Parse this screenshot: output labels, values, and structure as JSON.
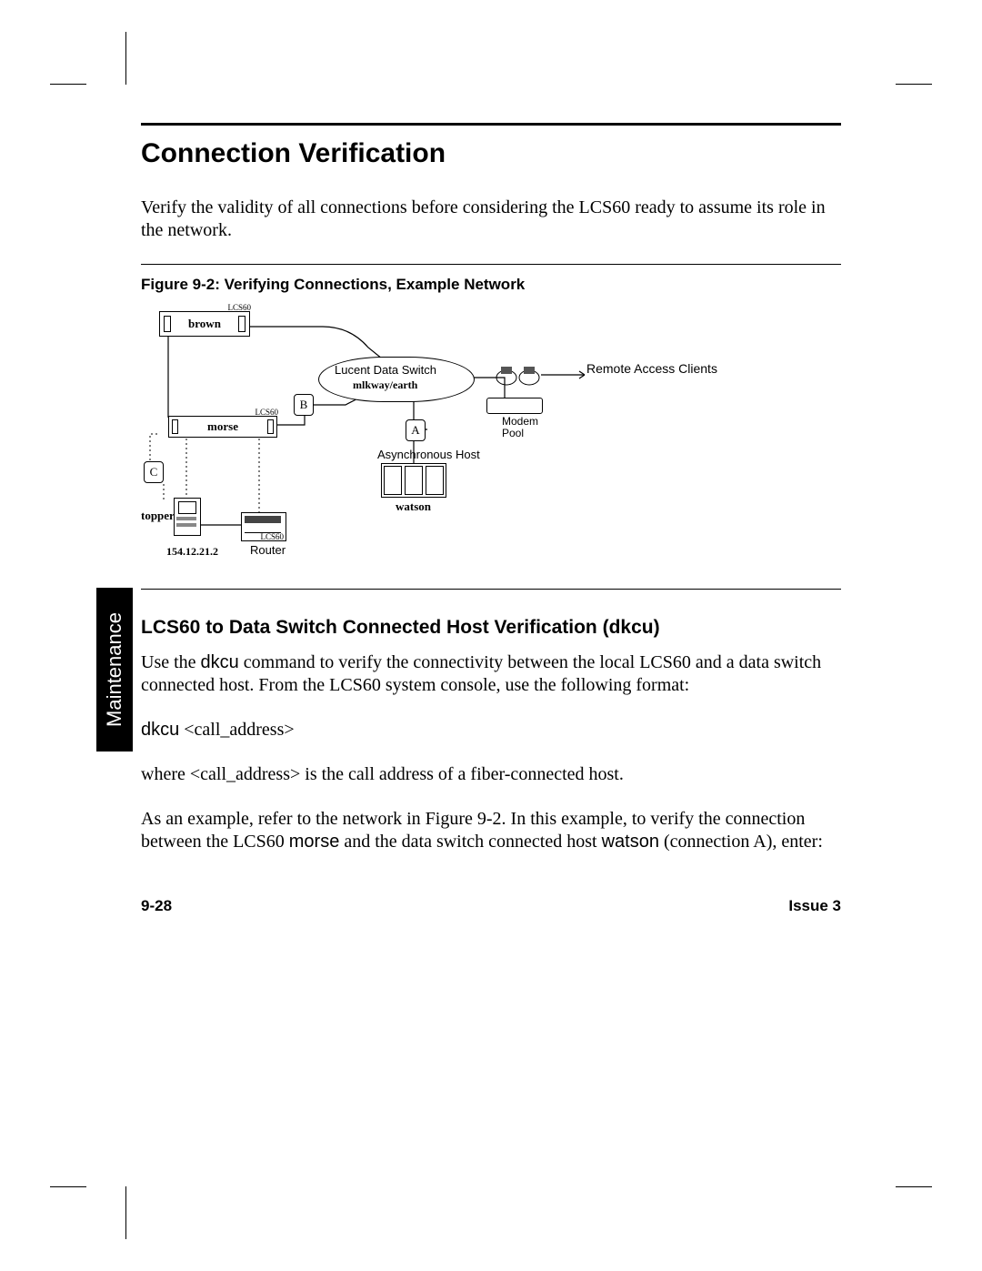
{
  "sideTab": "Maintenance",
  "section": {
    "title": "Connection Verification",
    "intro": "Verify the validity of all connections before considering the LCS60 ready to assume its role in the network."
  },
  "figure": {
    "caption": "Figure 9-2:   Verifying Connections, Example Network",
    "labels": {
      "brown": "brown",
      "lcs60_top": "LCS60",
      "morse": "morse",
      "lcs60_mid": "LCS60",
      "cloud_top": "Lucent Data Switch",
      "cloud_bottom": "mlkway/earth",
      "remote": "Remote Access Clients",
      "modem": "Modem Pool",
      "asyncHost": "Asynchronous Host",
      "watson": "watson",
      "topper": "topper",
      "ip": "154.12.21.2",
      "router": "Router",
      "nodeA": "A",
      "nodeB": "B",
      "nodeC": "C"
    }
  },
  "sub": {
    "title": "LCS60 to Data Switch Connected Host Verification (dkcu)",
    "p1a": "Use the ",
    "p1_cmd": "dkcu",
    "p1b": " command to verify the connectivity between the local LCS60 and a data switch connected host.  From the LCS60 system console, use the following format:",
    "cmd_line_a": "dkcu",
    "cmd_line_b": "  <call_address>",
    "p2": "where <call_address> is the call address of a fiber-connected host.",
    "p3a": "As an example, refer to the network in Figure 9-2. In this example, to verify the connection between the LCS60 ",
    "p3_morse": "morse",
    "p3b": " and the data switch connected host ",
    "p3_watson": "watson",
    "p3c": " (connection A), enter:"
  },
  "footer": {
    "left": "9-28",
    "right": "Issue 3"
  }
}
